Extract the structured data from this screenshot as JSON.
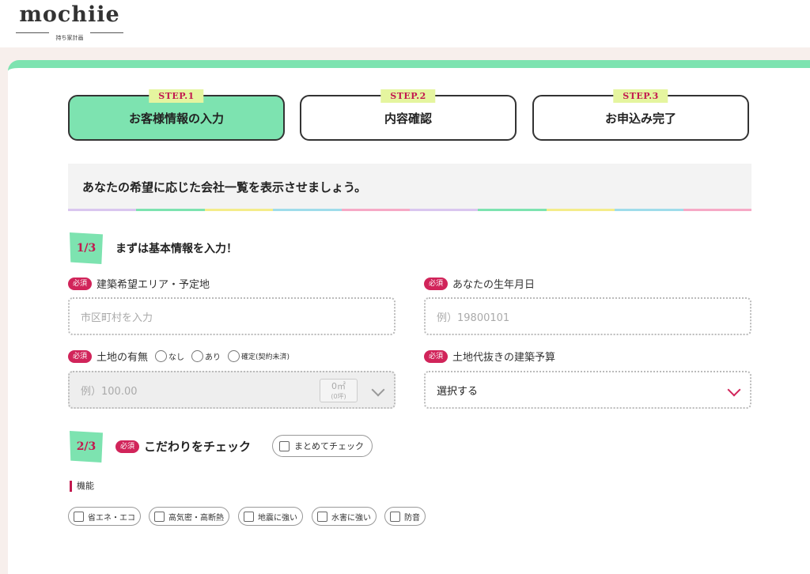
{
  "brand": {
    "logo": "mochiie",
    "tagline": "持ち家計画"
  },
  "steps": [
    {
      "tag": "STEP.1",
      "label": "お客様情報の入力",
      "active": true
    },
    {
      "tag": "STEP.2",
      "label": "内容確認",
      "active": false
    },
    {
      "tag": "STEP.3",
      "label": "お申込み完了",
      "active": false
    }
  ],
  "intro": "あなたの希望に応じた会社一覧を表示させましょう。",
  "colors": {
    "accent_green": "#7de3b0",
    "accent_pink": "#d1245a",
    "tag_yellow": "#e5f59f",
    "rainbow": [
      "#d9c6ef",
      "#7de3b0",
      "#f4ec8a",
      "#9fdcea",
      "#f6a9c6",
      "#d9c6ef",
      "#7de3b0",
      "#f4ec8a",
      "#9fdcea",
      "#f6a9c6"
    ]
  },
  "required_label": "必須",
  "section1": {
    "num": "1/3",
    "title": "まずは基本情報を入力！",
    "area": {
      "label": "建築希望エリア・予定地",
      "placeholder": "市区町村を入力"
    },
    "birth": {
      "label": "あなたの生年月日",
      "placeholder": "例）19800101"
    },
    "land": {
      "label": "土地の有無",
      "options": [
        "なし",
        "あり",
        "確定(契約未済)"
      ],
      "placeholder": "例）100.00",
      "unit": "0㎡",
      "unit_sub": "(0坪)"
    },
    "budget": {
      "label": "土地代抜きの建築予算",
      "value": "選択する"
    }
  },
  "section2": {
    "num": "2/3",
    "title": "こだわりをチェック",
    "check_all": "まとめてチェック",
    "func_label": "機能",
    "features": [
      "省エネ・エコ",
      "高気密・高断熱",
      "地震に強い",
      "水害に強い",
      "防音"
    ]
  }
}
